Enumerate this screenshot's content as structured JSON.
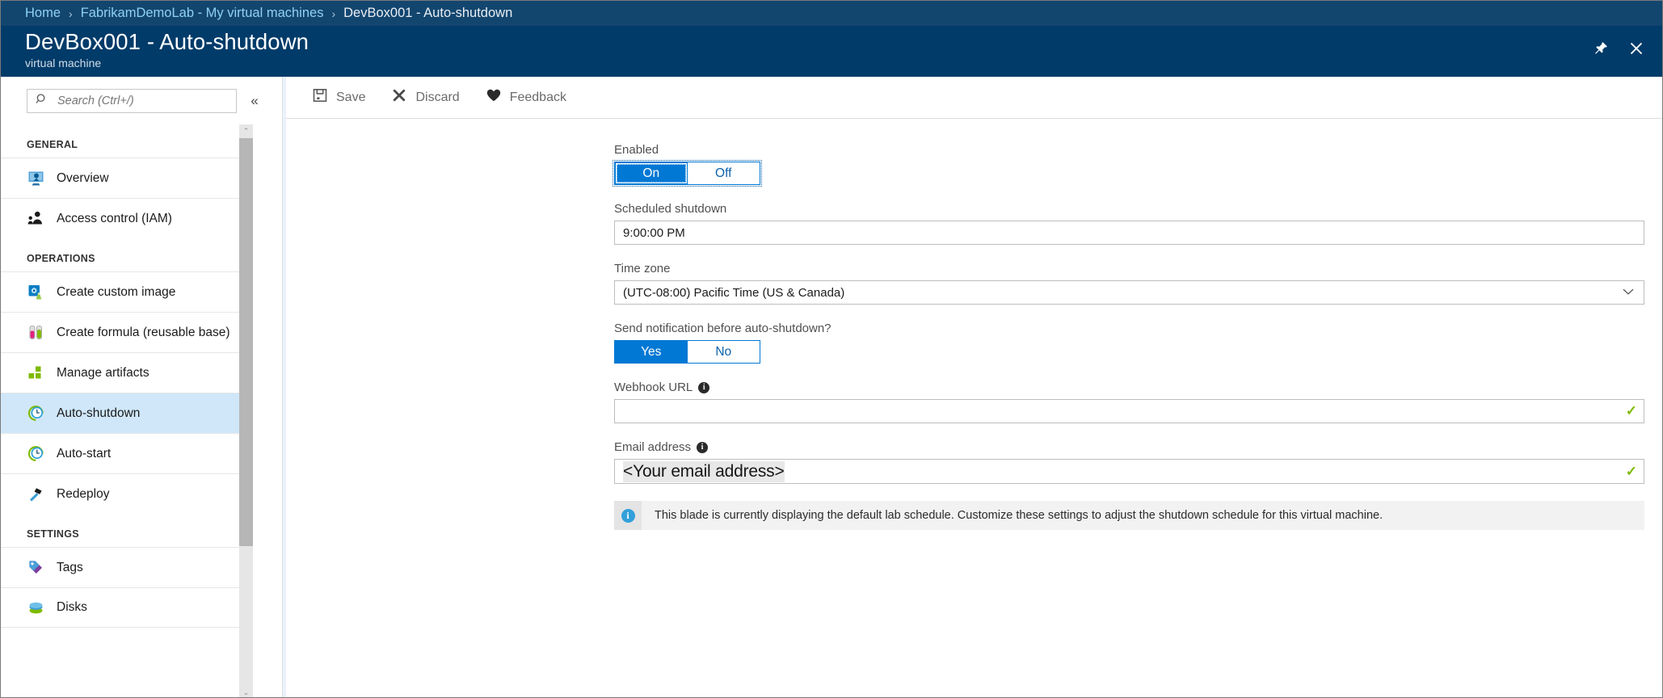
{
  "breadcrumb": {
    "items": [
      {
        "label": "Home",
        "current": false
      },
      {
        "label": "FabrikamDemoLab - My virtual machines",
        "current": false
      },
      {
        "label": "DevBox001 - Auto-shutdown",
        "current": true
      }
    ],
    "separator": "›"
  },
  "header": {
    "title": "DevBox001 - Auto-shutdown",
    "subtitle": "virtual machine",
    "pin_icon": "pin-icon",
    "close_icon": "close-icon"
  },
  "search": {
    "placeholder": "Search (Ctrl+/)",
    "value": "",
    "icon": "search-icon",
    "collapse_icon": "chevron-double-left-icon",
    "collapse_label": "«"
  },
  "sidebar": {
    "sections": [
      {
        "title": "GENERAL",
        "items": [
          {
            "label": "Overview",
            "icon": "overview-monitor-icon",
            "selected": false
          },
          {
            "label": "Access control (IAM)",
            "icon": "access-control-people-icon",
            "selected": false
          }
        ]
      },
      {
        "title": "OPERATIONS",
        "items": [
          {
            "label": "Create custom image",
            "icon": "custom-image-disk-icon",
            "selected": false
          },
          {
            "label": "Create formula (reusable base)",
            "icon": "formula-testtubes-icon",
            "selected": false
          },
          {
            "label": "Manage artifacts",
            "icon": "manage-artifacts-squares-icon",
            "selected": false
          },
          {
            "label": "Auto-shutdown",
            "icon": "clock-icon",
            "selected": true
          },
          {
            "label": "Auto-start",
            "icon": "clock-icon",
            "selected": false
          },
          {
            "label": "Redeploy",
            "icon": "redeploy-hammer-icon",
            "selected": false
          }
        ]
      },
      {
        "title": "SETTINGS",
        "items": [
          {
            "label": "Tags",
            "icon": "tag-icon",
            "selected": false
          },
          {
            "label": "Disks",
            "icon": "disks-icon",
            "selected": false
          }
        ]
      }
    ],
    "scrollbar": {
      "up_arrow": "⌃",
      "down_arrow": "⌄"
    }
  },
  "toolbar": {
    "buttons": [
      {
        "label": "Save",
        "icon": "save-floppy-icon"
      },
      {
        "label": "Discard",
        "icon": "discard-x-icon"
      },
      {
        "label": "Feedback",
        "icon": "feedback-heart-icon"
      }
    ]
  },
  "form": {
    "enabled": {
      "label": "Enabled",
      "options": [
        "On",
        "Off"
      ],
      "selected": "On"
    },
    "scheduled_shutdown": {
      "label": "Scheduled shutdown",
      "value": "9:00:00 PM"
    },
    "time_zone": {
      "label": "Time zone",
      "value": "(UTC-08:00) Pacific Time (US & Canada)",
      "chevron": "⌄"
    },
    "send_notification": {
      "label": "Send notification before auto-shutdown?",
      "options": [
        "Yes",
        "No"
      ],
      "selected": "Yes"
    },
    "webhook_url": {
      "label": "Webhook URL",
      "info": "i",
      "value": "",
      "valid_mark": "✓"
    },
    "email_address": {
      "label": "Email address",
      "info": "i",
      "value": "<Your email address>",
      "valid_mark": "✓"
    },
    "notice": {
      "icon": "info-circle-icon",
      "icon_glyph": "i",
      "text": "This blade is currently displaying the default lab schedule. Customize these settings to adjust the shutdown schedule for this virtual machine."
    }
  },
  "colors": {
    "breadcrumb_bg": "#13466f",
    "header_bg": "#003b69",
    "accent_blue": "#0078d4",
    "link_blue": "#8fd0f5",
    "selected_item_bg": "#cfe7f9",
    "valid_green": "#7fba00"
  }
}
